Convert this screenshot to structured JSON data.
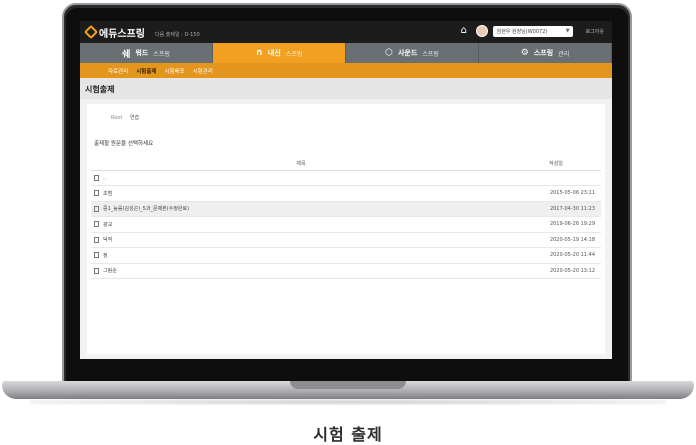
{
  "app": {
    "logo": "에듀스프링",
    "badge": "다음 출제일 : D-150",
    "user": "임현우 원장님(W0072)",
    "logout": "로그아웃"
  },
  "nav": [
    {
      "icon": "쉐",
      "label": "워드",
      "sub": "스프링",
      "active": false
    },
    {
      "icon": "∩",
      "label": "내신",
      "sub": "스프링",
      "active": true
    },
    {
      "icon": "⬡",
      "label": "사운드",
      "sub": "스프링",
      "active": false
    },
    {
      "icon": "⚙",
      "label": "스프링",
      "sub": "관리",
      "active": false
    }
  ],
  "subnav": [
    {
      "label": "자료관리",
      "active": false
    },
    {
      "label": "시험출제",
      "active": true
    },
    {
      "label": "시험배포",
      "active": false
    },
    {
      "label": "시험관리",
      "active": false
    }
  ],
  "page": {
    "title": "시험출제",
    "root_label": "Root",
    "root_value": "연습",
    "instruction": "출제할 원문을 선택하세요",
    "col_title": "제목",
    "col_date": "작성일"
  },
  "rows": [
    {
      "name": "..",
      "date": "",
      "highlight": false
    },
    {
      "name": "초범",
      "date": "2015-05-06 23:11",
      "highlight": false
    },
    {
      "name": "중1_능률(김성곤)_5과_문제본(수정완료)",
      "date": "2017-04-30 11:23",
      "highlight": true
    },
    {
      "name": "광교",
      "date": "2019-06-26 19:29",
      "highlight": false
    },
    {
      "name": "덕적",
      "date": "2020-05-19 14:18",
      "highlight": false
    },
    {
      "name": "정",
      "date": "2020-05-20 11:44",
      "highlight": false
    },
    {
      "name": "그림순",
      "date": "2020-05-20 13:12",
      "highlight": false
    }
  ],
  "caption": "시험 출제"
}
